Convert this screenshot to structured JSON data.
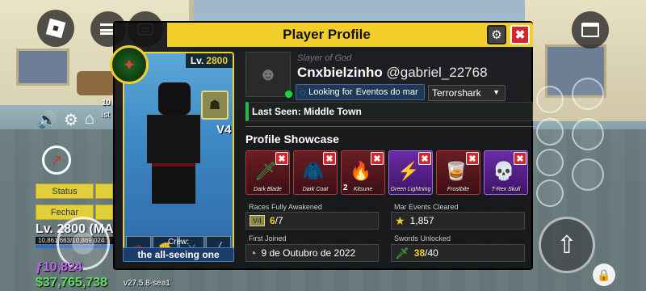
{
  "panel": {
    "title": "Player Profile",
    "settings_icon": "gear-icon",
    "close_icon": "close-icon",
    "close_glyph": "✖",
    "settings_glyph": "⚙"
  },
  "character": {
    "level_label": "Lv.",
    "level_value": "2800",
    "race_version": "V4",
    "crew_label": "Crew:",
    "crew_name": "the all-seeing one"
  },
  "profile": {
    "title_tag": "Slayer of God",
    "display_name": "Cnxbielzinho",
    "username": "@gabriel_22768",
    "looking_for_label": "Looking for",
    "looking_for_value": "Eventos do mar",
    "dropdown_value": "Terrorshark",
    "last_seen": "Last Seen: Middle Town"
  },
  "showcase": {
    "title": "Profile Showcase",
    "items": [
      {
        "label": "Dark Blade",
        "glyph": "🗡",
        "color": "#2ea84a",
        "qty": "",
        "rarity": "red"
      },
      {
        "label": "Dark Coat",
        "glyph": "🧥",
        "color": "#222222",
        "qty": "",
        "rarity": "red"
      },
      {
        "label": "Kitsune",
        "glyph": "🔥",
        "color": "#3b8cff",
        "qty": "2",
        "rarity": "red"
      },
      {
        "label": "Green Lightning",
        "glyph": "⚡",
        "color": "#7ed957",
        "qty": "",
        "rarity": "purple"
      },
      {
        "label": "Frostbite",
        "glyph": "🥃",
        "color": "#6fbcd6",
        "qty": "",
        "rarity": "red"
      },
      {
        "label": "T-Rex Skull",
        "glyph": "💀",
        "color": "#e8d7a8",
        "qty": "",
        "rarity": "purple"
      }
    ]
  },
  "stats": {
    "races_label": "Races Fully Awakened",
    "races_current": "6",
    "races_total": "/7",
    "mar_label": "Mar Events Cleared",
    "mar_value": "1,857",
    "joined_label": "First Joined",
    "joined_value": "9 de Outubro de 2022",
    "swords_label": "Swords Unlocked",
    "swords_current": "38",
    "swords_total": "/40",
    "races_badge": "V4"
  },
  "hud": {
    "status_label": "Status",
    "fechar_label": "Fechar",
    "level_text": "Lv. 2800 (MA",
    "hp_text": "10,861,663/10,869,024",
    "fragments": "ƒ10,824",
    "money": "$37,765,738",
    "version": "v27.5.8-sea1",
    "partial_text_1": "10",
    "partial_text_2": "ist"
  }
}
